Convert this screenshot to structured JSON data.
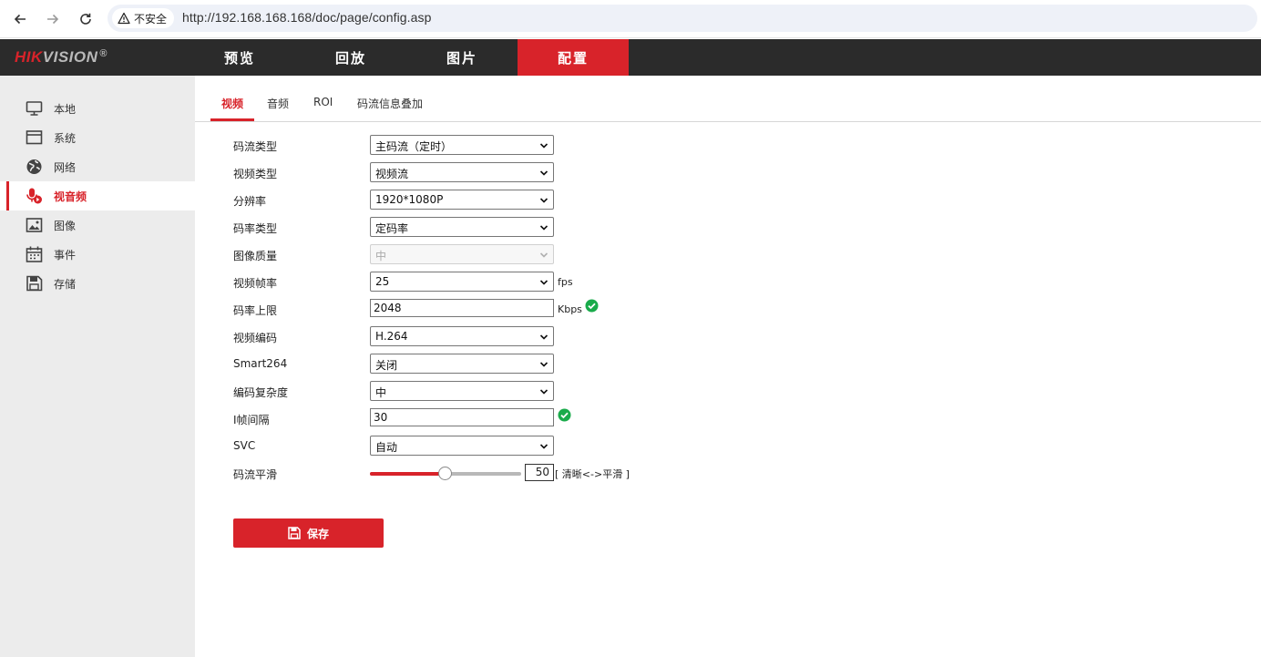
{
  "browser": {
    "security_label": "不安全",
    "url": "http://192.168.168.168/doc/page/config.asp"
  },
  "header": {
    "logo_red": "HIK",
    "logo_gray": "VISION",
    "logo_reg": "®",
    "nav": [
      {
        "label": "预览",
        "active": false
      },
      {
        "label": "回放",
        "active": false
      },
      {
        "label": "图片",
        "active": false
      },
      {
        "label": "配置",
        "active": true
      }
    ]
  },
  "sidebar": {
    "items": [
      {
        "label": "本地",
        "icon": "monitor-icon"
      },
      {
        "label": "系统",
        "icon": "system-window-icon"
      },
      {
        "label": "网络",
        "icon": "globe-icon"
      },
      {
        "label": "视音频",
        "icon": "microphone-icon",
        "active": true
      },
      {
        "label": "图像",
        "icon": "image-icon"
      },
      {
        "label": "事件",
        "icon": "calendar-icon"
      },
      {
        "label": "存储",
        "icon": "floppy-disk-icon"
      }
    ]
  },
  "tabs": [
    {
      "label": "视频",
      "active": true
    },
    {
      "label": "音频"
    },
    {
      "label": "ROI"
    },
    {
      "label": "码流信息叠加"
    }
  ],
  "form": {
    "stream_type": {
      "label": "码流类型",
      "value": "主码流（定时）"
    },
    "video_type": {
      "label": "视频类型",
      "value": "视频流"
    },
    "resolution": {
      "label": "分辨率",
      "value": "1920*1080P"
    },
    "bitrate_type": {
      "label": "码率类型",
      "value": "定码率"
    },
    "image_quality": {
      "label": "图像质量",
      "value": "中"
    },
    "frame_rate": {
      "label": "视频帧率",
      "value": "25",
      "unit": "fps"
    },
    "max_bitrate": {
      "label": "码率上限",
      "value": "2048",
      "unit": "Kbps"
    },
    "video_encoding": {
      "label": "视频编码",
      "value": "H.264"
    },
    "smart264": {
      "label": "Smart264",
      "value": "关闭"
    },
    "encoding_complexity": {
      "label": "编码复杂度",
      "value": "中"
    },
    "i_frame_interval": {
      "label": "I帧间隔",
      "value": "30"
    },
    "svc": {
      "label": "SVC",
      "value": "自动"
    },
    "stream_smoothing": {
      "label": "码流平滑",
      "value": "50",
      "hint": "[ 清晰<->平滑 ]",
      "level": 0.5
    }
  },
  "save_label": "保存",
  "colors": {
    "brand_red": "#d8232a",
    "header_bg": "#2b2b2b",
    "sidebar_bg": "#ececec",
    "ok_green": "#1aab4b"
  }
}
